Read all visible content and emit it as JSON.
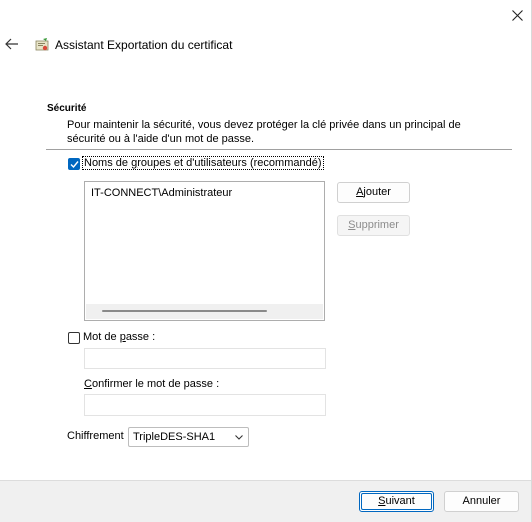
{
  "window": {
    "title": "Assistant Exportation du certificat"
  },
  "section": {
    "title": "Sécurité",
    "description": "Pour maintenir la sécurité, vous devez protéger la clé privée dans un principal de sécurité ou à l'aide d'un mot de passe."
  },
  "groups": {
    "checkbox_label_a": "Noms de ",
    "checkbox_label_u": "g",
    "checkbox_label_b": "roupes et d'utilisateurs (recommandé)",
    "checked": true,
    "items": [
      "IT-CONNECT\\Administrateur"
    ],
    "add_label_u": "A",
    "add_label_rest": "jouter",
    "remove_label_u": "S",
    "remove_label_rest": "upprimer"
  },
  "password": {
    "checkbox_label_a": "Mot de ",
    "checkbox_label_u": "p",
    "checkbox_label_b": "asse :",
    "checked": false,
    "value": "",
    "confirm_label_u": "C",
    "confirm_label_rest": "onfirmer le mot de passe :",
    "confirm_value": ""
  },
  "encryption": {
    "label": "Chiffrement",
    "selected": "TripleDES-SHA1"
  },
  "footer": {
    "next_u": "S",
    "next_rest": "uivant",
    "cancel": "Annuler"
  },
  "colors": {
    "accent": "#0067c0",
    "footer_bg": "#f0f0f0"
  },
  "icons": {
    "close": "close-icon",
    "back": "back-arrow-icon",
    "wizard": "certificate-wizard-icon",
    "dropdown": "chevron-down-icon"
  }
}
